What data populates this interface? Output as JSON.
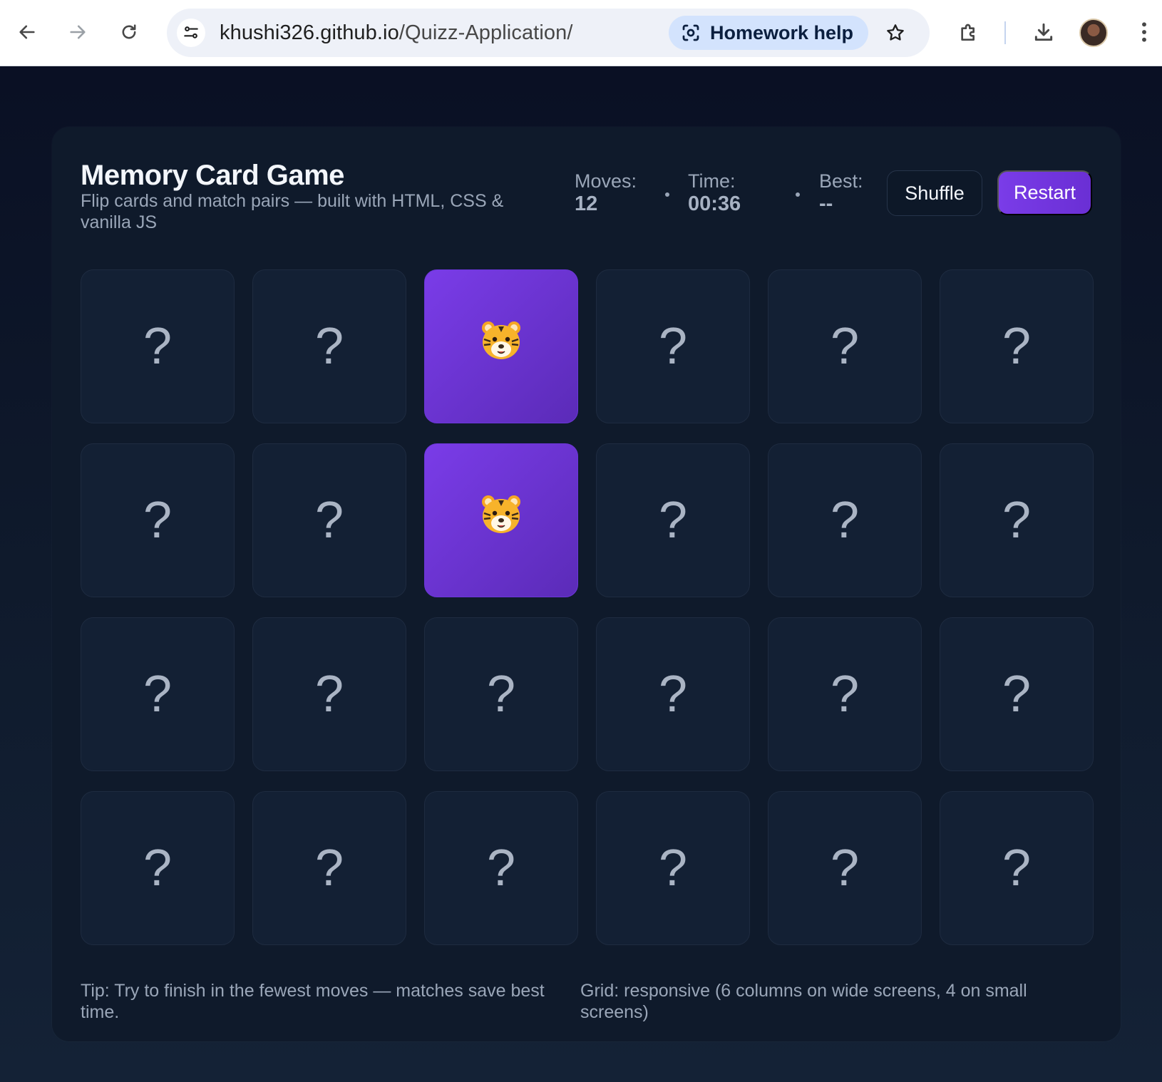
{
  "browser": {
    "url_host": "khushi326.github.io",
    "url_path": "/Quizz-Application/",
    "chip_label": "Homework help",
    "icons": [
      "back-arrow-icon",
      "forward-arrow-icon",
      "reload-icon",
      "site-info-icon",
      "lens-icon",
      "star-icon",
      "extensions-icon",
      "download-icon",
      "avatar",
      "kebab-menu-icon"
    ]
  },
  "game": {
    "title": "Memory Card Game",
    "subtitle": "Flip cards and match pairs — built with HTML, CSS & vanilla JS",
    "moves_label": "Moves:",
    "moves_value": "12",
    "time_label": "Time:",
    "time_value": "00:36",
    "best_label": "Best:",
    "best_value": "--",
    "shuffle_label": "Shuffle",
    "restart_label": "Restart",
    "hidden_symbol": "?",
    "grid_columns": 6,
    "grid_rows": 4,
    "cards": [
      {
        "state": "hidden"
      },
      {
        "state": "hidden"
      },
      {
        "state": "flipped",
        "face": "tiger"
      },
      {
        "state": "hidden"
      },
      {
        "state": "hidden"
      },
      {
        "state": "hidden"
      },
      {
        "state": "hidden"
      },
      {
        "state": "hidden"
      },
      {
        "state": "flipped",
        "face": "tiger"
      },
      {
        "state": "hidden"
      },
      {
        "state": "hidden"
      },
      {
        "state": "hidden"
      },
      {
        "state": "hidden"
      },
      {
        "state": "hidden"
      },
      {
        "state": "hidden"
      },
      {
        "state": "hidden"
      },
      {
        "state": "hidden"
      },
      {
        "state": "hidden"
      },
      {
        "state": "hidden"
      },
      {
        "state": "hidden"
      },
      {
        "state": "hidden"
      },
      {
        "state": "hidden"
      },
      {
        "state": "hidden"
      },
      {
        "state": "hidden"
      }
    ],
    "tip": "Tip: Try to finish in the fewest moves — matches save best time.",
    "grid_note": "Grid: responsive (6 columns on wide screens, 4 on small screens)"
  },
  "colors": {
    "accent": "#7a3ce8",
    "background": "#0f1a2b",
    "card_back": "#132034",
    "muted_text": "#9aa6b8"
  }
}
